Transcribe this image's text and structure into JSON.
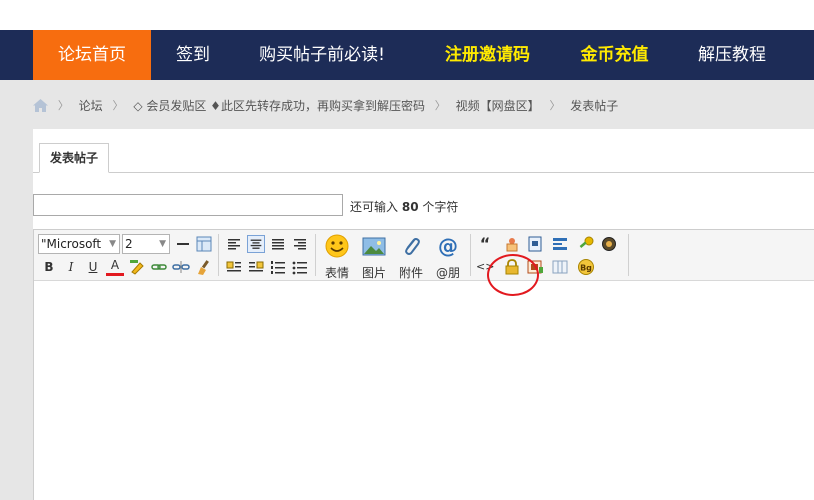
{
  "nav": {
    "items": [
      {
        "label": "论坛首页",
        "active": true
      },
      {
        "label": "签到"
      },
      {
        "label": "购买帖子前必读!"
      },
      {
        "label": "注册邀请码",
        "highlight": true
      },
      {
        "label": "金币充值",
        "highlight": true
      },
      {
        "label": "解压教程"
      }
    ],
    "colors": {
      "bar": "#1d2c57",
      "active": "#f76d0f",
      "highlight": "#ffea00"
    }
  },
  "breadcrumb": {
    "items": [
      "论坛",
      "◇ 会员发贴区 ♦此区先转存成功，再购买拿到解压密码",
      "视频【网盘区】",
      "发表帖子"
    ],
    "separator": "〉"
  },
  "tab": {
    "label": "发表帖子"
  },
  "subject": {
    "value": "",
    "placeholder": ""
  },
  "counter": {
    "prefix": "还可输入",
    "count": "80",
    "suffix": "个字符"
  },
  "editor": {
    "font_select": "\"Microsoft",
    "size_select": "2",
    "bold": "B",
    "italic": "I",
    "underline": "U",
    "fontcolor": "A",
    "quote": "“",
    "code": "<>",
    "bg_label": "Bg",
    "emoji_label": "表情",
    "image_label": "图片",
    "attach_label": "附件",
    "at_label": "@朋"
  },
  "annotation": {
    "color": "#e2191f"
  }
}
